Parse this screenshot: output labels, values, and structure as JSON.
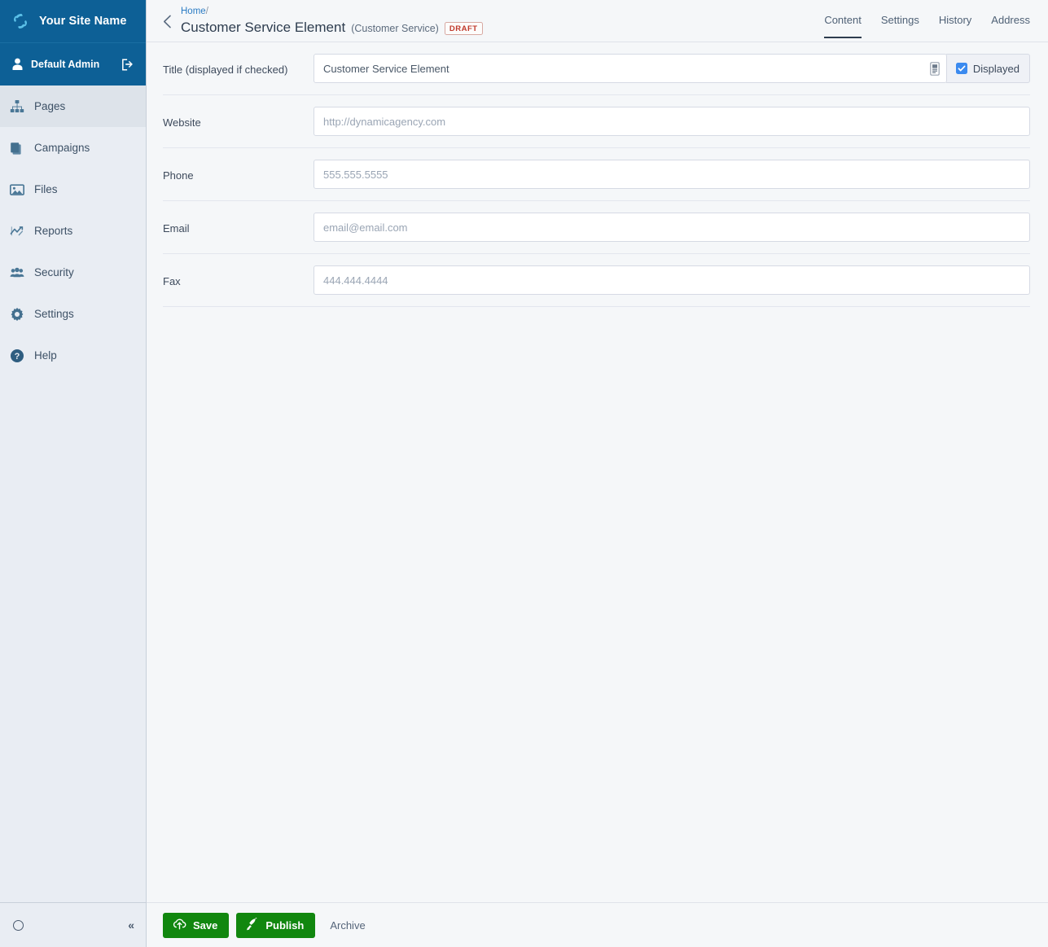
{
  "sidebar": {
    "brand": {
      "name": "Your Site Name",
      "logo_icon": "swoosh-logo-icon"
    },
    "user": {
      "name": "Default Admin",
      "icon": "user-icon",
      "logout_icon": "logout-icon"
    },
    "items": [
      {
        "label": "Pages",
        "icon": "sitemap-icon",
        "active": true
      },
      {
        "label": "Campaigns",
        "icon": "copy-icon",
        "active": false
      },
      {
        "label": "Files",
        "icon": "image-icon",
        "active": false
      },
      {
        "label": "Reports",
        "icon": "chart-line-icon",
        "active": false
      },
      {
        "label": "Security",
        "icon": "users-icon",
        "active": false
      },
      {
        "label": "Settings",
        "icon": "gear-icon",
        "active": false
      },
      {
        "label": "Help",
        "icon": "question-circle-icon",
        "active": false
      }
    ],
    "footer": {
      "status_icon": "circle-icon",
      "collapse_label": "«"
    }
  },
  "header": {
    "back_icon": "chevron-left-icon",
    "breadcrumb": {
      "home": "Home",
      "separator": "/"
    },
    "title": "Customer Service Element",
    "subtitle": "(Customer Service)",
    "status_badge": "DRAFT",
    "tabs": [
      {
        "label": "Content",
        "active": true
      },
      {
        "label": "Settings",
        "active": false
      },
      {
        "label": "History",
        "active": false
      },
      {
        "label": "Address",
        "active": false
      }
    ]
  },
  "form": {
    "fields": [
      {
        "label": "Title (displayed if checked)",
        "value": "Customer Service Element",
        "placeholder": "",
        "inner_icon": "device-icon",
        "checkbox": {
          "label": "Displayed",
          "checked": true
        }
      },
      {
        "label": "Website",
        "value": "",
        "placeholder": "http://dynamicagency.com"
      },
      {
        "label": "Phone",
        "value": "",
        "placeholder": "555.555.5555"
      },
      {
        "label": "Email",
        "value": "",
        "placeholder": "email@email.com"
      },
      {
        "label": "Fax",
        "value": "",
        "placeholder": "444.444.4444"
      }
    ]
  },
  "footer": {
    "save_label": "Save",
    "save_icon": "cloud-upload-icon",
    "publish_label": "Publish",
    "publish_icon": "rocket-icon",
    "archive_label": "Archive"
  },
  "colors": {
    "brand_blue": "#0d6096",
    "sidebar_bg": "#e9edf3",
    "content_bg": "#f5f7f9",
    "accent_green": "#11870f",
    "checkbox_blue": "#3b8aef",
    "draft_red": "#c0392b",
    "link_blue": "#2b7cc4"
  }
}
